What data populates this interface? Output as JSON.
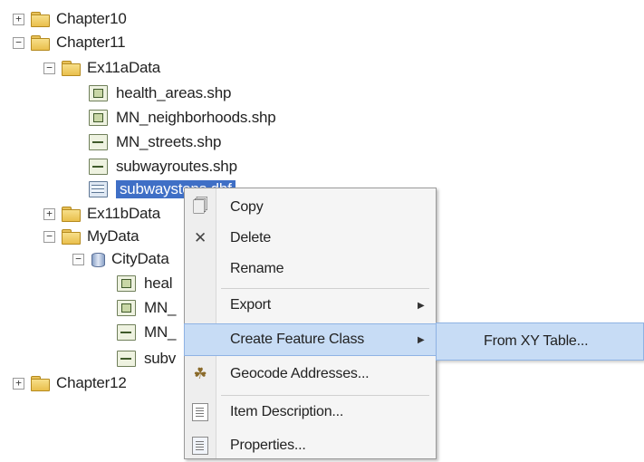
{
  "tree": {
    "items": [
      {
        "label": "Chapter10",
        "expander": "+"
      },
      {
        "label": "Chapter11",
        "expander": "−"
      },
      {
        "label": "Ex11aData",
        "expander": "−"
      },
      {
        "label": "health_areas.shp"
      },
      {
        "label": "MN_neighborhoods.shp"
      },
      {
        "label": "MN_streets.shp"
      },
      {
        "label": "subwayroutes.shp"
      },
      {
        "label": "subwaystops.dbf"
      },
      {
        "label": "Ex11bData",
        "expander": "+"
      },
      {
        "label": "MyData",
        "expander": "−"
      },
      {
        "label": "CityData",
        "expander": "−"
      },
      {
        "label": "heal"
      },
      {
        "label": "MN_"
      },
      {
        "label": "MN_"
      },
      {
        "label": "subv"
      },
      {
        "label": "Chapter12",
        "expander": "+"
      }
    ]
  },
  "context_menu": {
    "items": [
      {
        "label": "Copy",
        "icon": "copy-icon"
      },
      {
        "label": "Delete",
        "icon": "delete-icon"
      },
      {
        "label": "Rename",
        "icon": ""
      },
      {
        "label": "Export",
        "icon": "",
        "submenu": true
      },
      {
        "label": "Create Feature Class",
        "icon": "",
        "submenu": true
      },
      {
        "label": "Geocode Addresses...",
        "icon": "geocode-icon"
      },
      {
        "label": "Item Description...",
        "icon": "item-description-icon"
      },
      {
        "label": "Properties...",
        "icon": "properties-icon"
      }
    ]
  },
  "submenu": {
    "items": [
      {
        "label": "From XY Table..."
      }
    ]
  },
  "colors": {
    "selection": "#3f6fc6",
    "menu_highlight": "#c7dcf5"
  }
}
